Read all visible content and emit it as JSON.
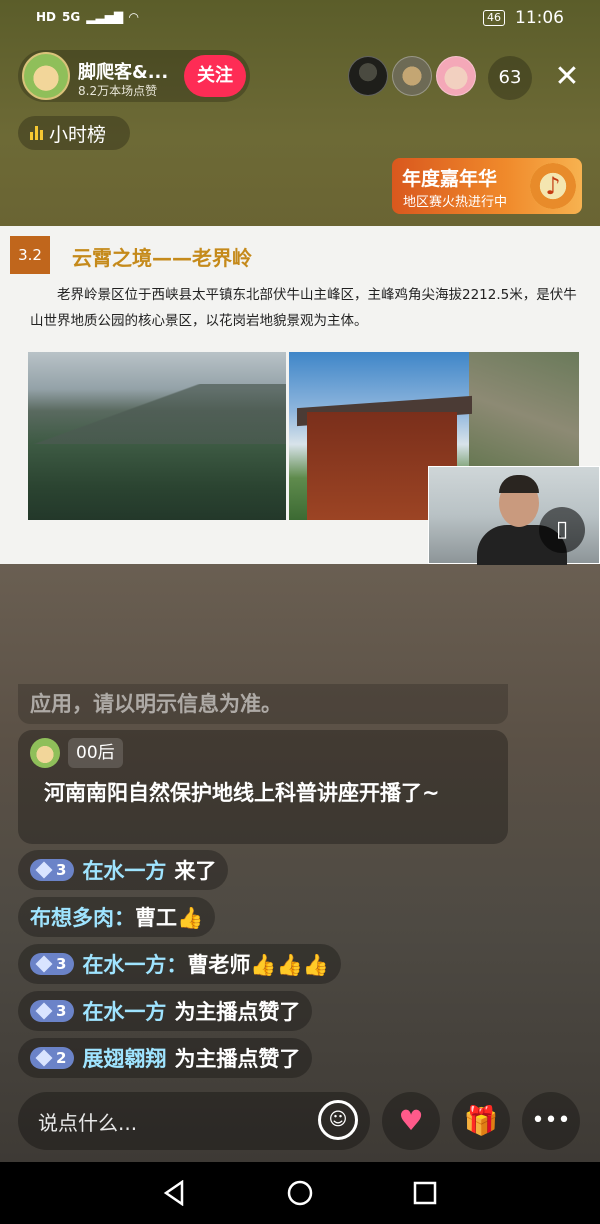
{
  "status": {
    "left_icons": [
      "HD",
      "5G",
      "signal-icon",
      "wifi-icon"
    ],
    "battery": "46",
    "time": "11:06"
  },
  "host": {
    "name": "脚爬客&...",
    "likes": "8.2万本场点赞",
    "follow_label": "关注"
  },
  "viewers": {
    "count": "63"
  },
  "rank": {
    "label": "小时榜"
  },
  "banner": {
    "title": "年度嘉年华",
    "subtitle": "地区赛火热进行中"
  },
  "slide": {
    "section_num": "3.2",
    "title": "云霄之境——老界岭",
    "paragraph": "老界岭景区位于西峡县太平镇东北部伏牛山主峰区，主峰鸡角尖海拔2212.5米，是伏牛山世界地质公园的核心景区，以花岗岩地貌景观为主体。"
  },
  "chat": {
    "faded": "应用，请以明示信息为准。",
    "card": {
      "tag": "00后",
      "text": "河南南阳自然保护地线上科普讲座开播了~"
    },
    "items": [
      {
        "level": "3",
        "user": "在水一方",
        "text": "来了"
      },
      {
        "user": "布想多肉：",
        "text": "曹工👍"
      },
      {
        "level": "3",
        "user": "在水一方：",
        "text": "曹老师👍👍👍"
      },
      {
        "level": "3",
        "user": "在水一方",
        "text": "为主播点赞了"
      },
      {
        "level": "2",
        "user": "展翅翱翔",
        "text": "为主播点赞了"
      }
    ]
  },
  "input": {
    "placeholder": "说点什么..."
  },
  "colors": {
    "follow": "#fe2c55",
    "accent_title": "#c58a1b",
    "section_bg": "#c0661c",
    "level_badge": "#6b83c8"
  }
}
